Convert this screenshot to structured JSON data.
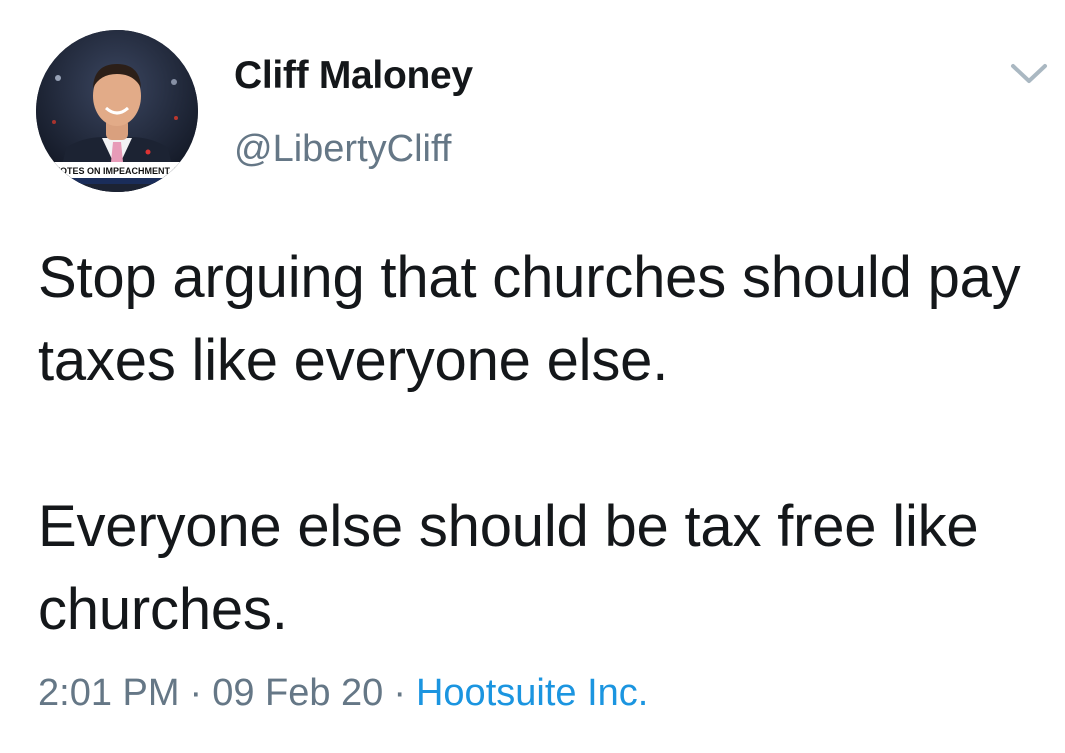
{
  "author": {
    "display_name": "Cliff Maloney",
    "handle": "@LibertyCliff",
    "avatar_banner_text": "VOTES ON IMPEACHMENT A"
  },
  "tweet": {
    "paragraphs": [
      "Stop arguing that churches should pay taxes like everyone else.",
      "Everyone else should be tax free like churches."
    ]
  },
  "meta": {
    "time": "2:01 PM",
    "separator": "·",
    "date": "09 Feb 20",
    "source": "Hootsuite Inc."
  },
  "icons": {
    "menu": "chevron-down-icon"
  },
  "colors": {
    "text": "#14171a",
    "secondary": "#657786",
    "link": "#1b95e0"
  }
}
